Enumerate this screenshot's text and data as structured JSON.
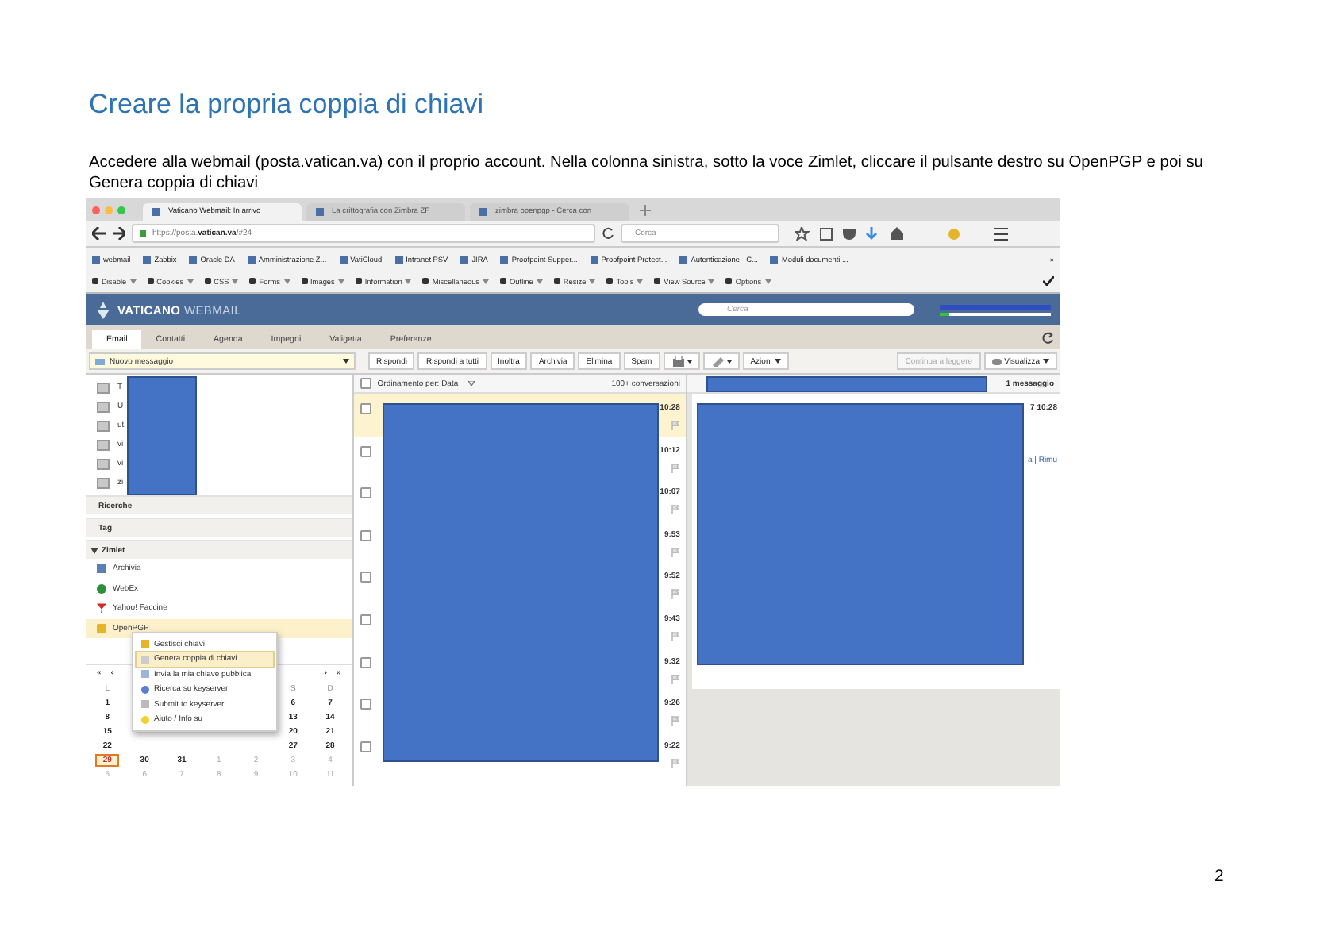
{
  "heading": "Creare la propria coppia di chiavi",
  "intro": "Accedere alla webmail (posta.vatican.va) con il proprio account. Nella colonna sinistra, sotto la voce Zimlet, cliccare il pulsante destro su OpenPGP e poi su Genera coppia di chiavi",
  "browser": {
    "tabs": [
      {
        "title": "Vaticano Webmail: In arrivo",
        "selected": true
      },
      {
        "title": "La crittografia con Zimbra ZF",
        "selected": false
      },
      {
        "title": "zimbra openpgp - Cerca con",
        "selected": false
      }
    ],
    "url_host": "https://posta.",
    "url_domain": "vatican.va",
    "url_path": "/#24",
    "search_placeholder": "Cerca",
    "bookmarks": [
      "webmail",
      "Zabbix",
      "Oracle DA",
      "Amministrazione Z...",
      "VatiCloud",
      "Intranet PSV",
      "JIRA",
      "Proofpoint Supper...",
      "Proofpoint Protect...",
      "Autenticazione - C...",
      "Moduli documenti ..."
    ],
    "bookmarks_more": "»",
    "devtools": [
      "Disable",
      "Cookies",
      "CSS",
      "Forms",
      "Images",
      "Information",
      "Miscellaneous",
      "Outline",
      "Resize",
      "Tools",
      "View Source",
      "Options"
    ]
  },
  "app": {
    "brand_bold": "VATICANO",
    "brand_light": "WEBMAIL",
    "search_placeholder": "Cerca",
    "tabs": [
      {
        "label": "Email",
        "selected": true
      },
      {
        "label": "Contatti",
        "selected": false
      },
      {
        "label": "Agenda",
        "selected": false
      },
      {
        "label": "Impegni",
        "selected": false
      },
      {
        "label": "Valigetta",
        "selected": false
      },
      {
        "label": "Preferenze",
        "selected": false
      }
    ],
    "new_message": "Nuovo messaggio",
    "actions": [
      {
        "label": "Rispondi",
        "disabled": false
      },
      {
        "label": "Rispondi a tutti",
        "disabled": false
      },
      {
        "label": "Inoltra",
        "disabled": false
      },
      {
        "label": "Archivia",
        "disabled": false
      },
      {
        "label": "Elimina",
        "disabled": false
      },
      {
        "label": "Spam",
        "disabled": false
      }
    ],
    "more_actions": "Azioni",
    "continue": {
      "label": "Continua a leggere",
      "disabled": true
    },
    "view": "Visualizza",
    "folders": [
      "T",
      "U",
      "ut",
      "vi",
      "vi",
      "zi"
    ],
    "sections": [
      "Ricerche",
      "Tag"
    ],
    "zimlet": {
      "label": "Zimlet",
      "expanded": true,
      "items": [
        {
          "label": "Archivia",
          "selected": false
        },
        {
          "label": "WebEx",
          "selected": false
        },
        {
          "label": "Yahoo! Faccine",
          "selected": false
        },
        {
          "label": "OpenPGP",
          "selected": true
        }
      ]
    },
    "context_menu": [
      {
        "label": "Gestisci chiavi",
        "selected": false
      },
      {
        "label": "Genera coppia di chiavi",
        "selected": true
      },
      {
        "label": "Invia la mia chiave pubblica",
        "selected": false
      },
      {
        "label": "Ricerca su keyserver",
        "selected": false
      },
      {
        "label": "Submit to keyserver",
        "selected": false
      },
      {
        "label": "Aiuto / Info su",
        "selected": false
      }
    ],
    "calendar": {
      "prev_year": "«",
      "prev_month": "‹",
      "next_month": "›",
      "next_year": "»",
      "weekdays": {
        "start": [
          "L"
        ],
        "end": [
          "S",
          "D"
        ]
      },
      "weeks": [
        {
          "start": [
            {
              "day": "1",
              "muted": false,
              "today": false
            }
          ],
          "end": [
            {
              "day": "6",
              "muted": false,
              "today": false
            },
            {
              "day": "7",
              "muted": false,
              "today": false
            }
          ]
        },
        {
          "start": [
            {
              "day": "8",
              "muted": false,
              "today": false
            }
          ],
          "end": [
            {
              "day": "13",
              "muted": false,
              "today": false
            },
            {
              "day": "14",
              "muted": false,
              "today": false
            }
          ]
        },
        {
          "start": [
            {
              "day": "15",
              "muted": false,
              "today": false
            }
          ],
          "end": [
            {
              "day": "20",
              "muted": false,
              "today": false
            },
            {
              "day": "21",
              "muted": false,
              "today": false
            }
          ]
        },
        {
          "start": [
            {
              "day": "22",
              "muted": false,
              "today": false
            }
          ],
          "end": [
            {
              "day": "27",
              "muted": false,
              "today": false
            },
            {
              "day": "28",
              "muted": false,
              "today": false
            }
          ]
        },
        {
          "start": [
            {
              "day": "29",
              "muted": false,
              "today": true
            },
            {
              "day": "30",
              "muted": false,
              "today": false
            },
            {
              "day": "31",
              "muted": false,
              "today": false
            },
            {
              "day": "1",
              "muted": true,
              "today": false
            },
            {
              "day": "2",
              "muted": true,
              "today": false
            },
            {
              "day": "3",
              "muted": true,
              "today": false
            },
            {
              "day": "4",
              "muted": true,
              "today": false
            }
          ]
        },
        {
          "start": [
            {
              "day": "5",
              "muted": true,
              "today": false
            },
            {
              "day": "6",
              "muted": true,
              "today": false
            },
            {
              "day": "7",
              "muted": true,
              "today": false
            },
            {
              "day": "8",
              "muted": true,
              "today": false
            },
            {
              "day": "9",
              "muted": true,
              "today": false
            },
            {
              "day": "10",
              "muted": true,
              "today": false
            },
            {
              "day": "11",
              "muted": true,
              "today": false
            }
          ]
        }
      ]
    },
    "list_sort": "Ordinamento per: Data",
    "list_count": "100+ conversazioni",
    "select_all_checked": false,
    "messages": [
      {
        "time": "10:28",
        "selected": true,
        "checked": false
      },
      {
        "time": "10:12",
        "selected": false,
        "checked": false
      },
      {
        "time": "10:07",
        "selected": false,
        "checked": false
      },
      {
        "time": "9:53",
        "selected": false,
        "checked": false
      },
      {
        "time": "9:52",
        "selected": false,
        "checked": false
      },
      {
        "time": "9:43",
        "selected": false,
        "checked": false
      },
      {
        "time": "9:32",
        "selected": false,
        "checked": false
      },
      {
        "time": "9:26",
        "selected": false,
        "checked": false
      },
      {
        "time": "9:22",
        "selected": false,
        "checked": false
      }
    ],
    "reading": {
      "count": "1 messaggio",
      "date": "7 10:28",
      "link": "a | Rimu"
    }
  },
  "page_number": "2"
}
